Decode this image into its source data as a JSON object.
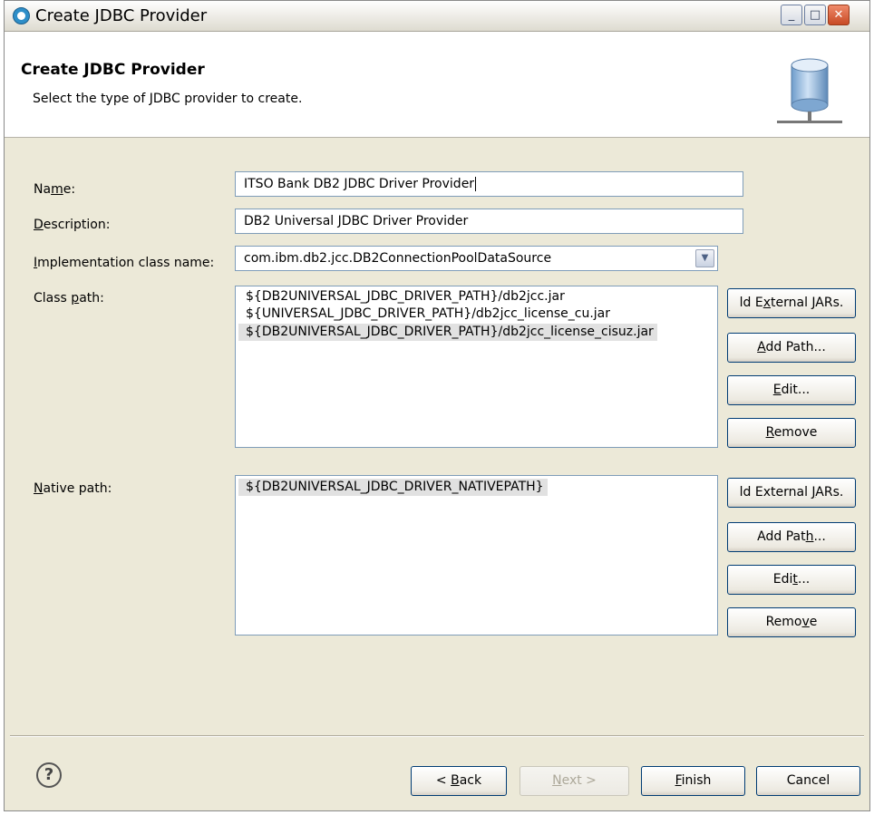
{
  "window": {
    "title": "Create JDBC Provider"
  },
  "header": {
    "title": "Create JDBC Provider",
    "description": "Select the type of JDBC provider to create."
  },
  "form": {
    "name": {
      "pre": "Na",
      "accel": "m",
      "post": "e:",
      "value": "ITSO Bank DB2 JDBC Driver Provider"
    },
    "description": {
      "pre": "",
      "accel": "D",
      "post": "escription:",
      "value": "DB2 Universal JDBC Driver Provider"
    },
    "implementation": {
      "pre": "",
      "accel": "I",
      "post": "mplementation class name:",
      "value": "com.ibm.db2.jcc.DB2ConnectionPoolDataSource"
    },
    "classpath": {
      "pre": "Class ",
      "accel": "p",
      "post": "ath:",
      "items": [
        "${DB2UNIVERSAL_JDBC_DRIVER_PATH}/db2jcc.jar",
        "${UNIVERSAL_JDBC_DRIVER_PATH}/db2jcc_license_cu.jar",
        "${DB2UNIVERSAL_JDBC_DRIVER_PATH}/db2jcc_license_cisuz.jar"
      ]
    },
    "nativepath": {
      "pre": "",
      "accel": "N",
      "post": "ative path:",
      "items": [
        "${DB2UNIVERSAL_JDBC_DRIVER_NATIVEPATH}"
      ]
    }
  },
  "classpath_buttons": {
    "add_jars": {
      "pre": "ld E",
      "accel": "x",
      "post": "ternal JARs."
    },
    "add_path": {
      "pre": "",
      "accel": "A",
      "post": "dd Path..."
    },
    "edit": {
      "pre": "",
      "accel": "E",
      "post": "dit..."
    },
    "remove": {
      "pre": "",
      "accel": "R",
      "post": "emove"
    }
  },
  "native_buttons": {
    "add_jars": {
      "pre": "ld External ",
      "accel": "J",
      "post": "ARs."
    },
    "add_path": {
      "pre": "Add Pat",
      "accel": "h",
      "post": "..."
    },
    "edit": {
      "pre": "Edi",
      "accel": "t",
      "post": "..."
    },
    "remove": {
      "pre": "Remo",
      "accel": "v",
      "post": "e"
    }
  },
  "footer": {
    "back": {
      "pre": "< ",
      "accel": "B",
      "post": "ack"
    },
    "next": {
      "pre": "",
      "accel": "N",
      "post": "ext >"
    },
    "finish": {
      "pre": "",
      "accel": "F",
      "post": "inish"
    },
    "cancel": "Cancel"
  },
  "icons": {
    "title": "app-icon",
    "header": "database-icon",
    "help": "help-icon"
  }
}
